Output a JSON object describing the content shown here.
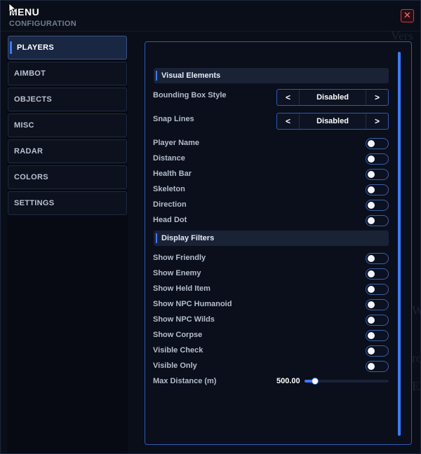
{
  "window": {
    "title": "MENU",
    "subtitle": "CONFIGURATION",
    "close_icon": "close-icon"
  },
  "background_ghost_text": [
    "Vers",
    "W",
    "ro",
    "E"
  ],
  "sidebar": {
    "items": [
      {
        "label": "PLAYERS",
        "active": true
      },
      {
        "label": "AIMBOT",
        "active": false
      },
      {
        "label": "OBJECTS",
        "active": false
      },
      {
        "label": "MISC",
        "active": false
      },
      {
        "label": "RADAR",
        "active": false
      },
      {
        "label": "COLORS",
        "active": false
      },
      {
        "label": "SETTINGS",
        "active": false
      }
    ]
  },
  "panel": {
    "sections": {
      "visual": "Visual Elements",
      "filters": "Display Filters"
    },
    "selectors": [
      {
        "label": "Bounding Box Style",
        "value": "Disabled",
        "prev": "<",
        "next": ">"
      },
      {
        "label": "Snap Lines",
        "value": "Disabled",
        "prev": "<",
        "next": ">"
      }
    ],
    "visual_toggles": [
      {
        "label": "Player Name",
        "on": false
      },
      {
        "label": "Distance",
        "on": false
      },
      {
        "label": "Health Bar",
        "on": false
      },
      {
        "label": "Skeleton",
        "on": false
      },
      {
        "label": "Direction",
        "on": false
      },
      {
        "label": "Head Dot",
        "on": false
      }
    ],
    "filter_toggles": [
      {
        "label": "Show Friendly",
        "on": false
      },
      {
        "label": "Show Enemy",
        "on": false
      },
      {
        "label": "Show Held Item",
        "on": false
      },
      {
        "label": "Show NPC Humanoid",
        "on": false
      },
      {
        "label": "Show NPC Wilds",
        "on": false
      },
      {
        "label": "Show Corpse",
        "on": false
      },
      {
        "label": "Visible Check",
        "on": false
      },
      {
        "label": "Visible Only",
        "on": false
      }
    ],
    "slider": {
      "label": "Max Distance (m)",
      "value_text": "500.00",
      "fraction": 0.09
    }
  },
  "colors": {
    "accent": "#3c7bff",
    "close": "#c43a4a"
  }
}
